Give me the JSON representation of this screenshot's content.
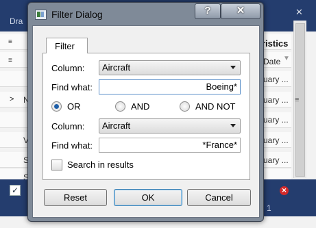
{
  "background_app": {
    "header_text": "Dra",
    "column_header": "ristics",
    "date_header": "Date",
    "cells": [
      "uary ...",
      "uary ...",
      "uary ...",
      "uary ...",
      "uary ..."
    ],
    "left_letters": [
      "N",
      "V",
      "S",
      "S"
    ],
    "footer_count": "1"
  },
  "dialog": {
    "title": "Filter Dialog",
    "help_glyph": "?",
    "close_glyph": "✕",
    "tab_label": "Filter",
    "column_label_1": "Column:",
    "column_value_1": "Aircraft",
    "find_label_1": "Find what:",
    "find_value_1": "Boeing*",
    "radio_or": "OR",
    "radio_and": "AND",
    "radio_and_not": "AND NOT",
    "selected_operator": "OR",
    "column_label_2": "Column:",
    "column_value_2": "Aircraft",
    "find_label_2": "Find what:",
    "find_value_2": "*France*",
    "search_in_results": "Search in results",
    "buttons": {
      "reset": "Reset",
      "ok": "OK",
      "cancel": "Cancel"
    }
  }
}
